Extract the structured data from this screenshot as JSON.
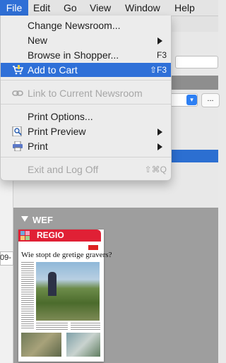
{
  "menubar": {
    "items": [
      "File",
      "Edit",
      "Go",
      "View",
      "Window",
      "Help"
    ],
    "active": "File"
  },
  "file_menu": {
    "items": [
      {
        "label": "Change Newsroom...",
        "shortcut": "",
        "submenu": false,
        "enabled": true,
        "highlighted": false,
        "icon": ""
      },
      {
        "label": "New",
        "shortcut": "",
        "submenu": true,
        "enabled": true,
        "highlighted": false,
        "icon": ""
      },
      {
        "label": "Browse in Shopper...",
        "shortcut": "F3",
        "submenu": false,
        "enabled": true,
        "highlighted": false,
        "icon": ""
      },
      {
        "label": "Add to Cart",
        "shortcut": "⇧F3",
        "submenu": false,
        "enabled": true,
        "highlighted": true,
        "icon": "cart-icon"
      },
      {
        "label": "Link to Current Newsroom",
        "shortcut": "",
        "submenu": false,
        "enabled": false,
        "highlighted": false,
        "icon": "link-icon"
      },
      {
        "label": "Print Options...",
        "shortcut": "",
        "submenu": false,
        "enabled": true,
        "highlighted": false,
        "icon": ""
      },
      {
        "label": "Print Preview",
        "shortcut": "",
        "submenu": true,
        "enabled": true,
        "highlighted": false,
        "icon": "print-preview-icon"
      },
      {
        "label": "Print",
        "shortcut": "",
        "submenu": true,
        "enabled": true,
        "highlighted": false,
        "icon": "printer-icon"
      },
      {
        "label": "Exit and Log Off",
        "shortcut": "⇧⌘Q",
        "submenu": false,
        "enabled": false,
        "highlighted": false,
        "icon": ""
      }
    ]
  },
  "background": {
    "combo_button_icon": "chevron-down-icon",
    "dots_button_label": "...",
    "left_field_value": "09-",
    "group_label": "WEF",
    "thumbnail": {
      "tag": "REGIO AdFam.2",
      "headline": "Wie stopt de gretige gravers?",
      "logo_text": "Regio"
    }
  },
  "colors": {
    "accent": "#2f70d8",
    "tag_red": "#e02035",
    "panel_gray": "#9e9e9e"
  }
}
